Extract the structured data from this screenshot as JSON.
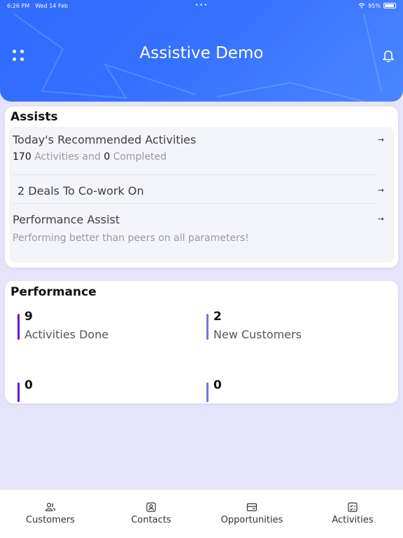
{
  "status_bar": {
    "time": "6:26 PM",
    "date": "Wed 14 Feb",
    "battery": "95%"
  },
  "header": {
    "title": "Assistive Demo",
    "menu_icon": "grid-dots-icon",
    "notification_icon": "bell-icon"
  },
  "assists": {
    "title": "Assists",
    "items": [
      {
        "title": "Today's Recommended Activities",
        "count_a": "170",
        "text_a": "Activities and",
        "count_b": "0",
        "text_b": "Completed"
      },
      {
        "title": "2 Deals To Co-work On"
      },
      {
        "title": "Performance Assist",
        "subtitle": "Performing better than peers on all parameters!"
      }
    ],
    "arrow": "→"
  },
  "performance": {
    "title": "Performance",
    "metrics": [
      {
        "value": "9",
        "label": "Activities Done",
        "color": "#6b1bb8"
      },
      {
        "value": "2",
        "label": "New Customers",
        "color": "#6d75d8"
      },
      {
        "value": "0",
        "label": "",
        "color": "#6b1bb8"
      },
      {
        "value": "0",
        "label": "",
        "color": "#6d75d8"
      }
    ]
  },
  "tabs": [
    {
      "label": "Customers",
      "icon": "customers-icon"
    },
    {
      "label": "Contacts",
      "icon": "contacts-icon"
    },
    {
      "label": "Opportunities",
      "icon": "opportunities-icon"
    },
    {
      "label": "Activities",
      "icon": "activities-icon"
    }
  ],
  "colors": {
    "header": "#3570ff",
    "background": "#e6e4fb"
  }
}
